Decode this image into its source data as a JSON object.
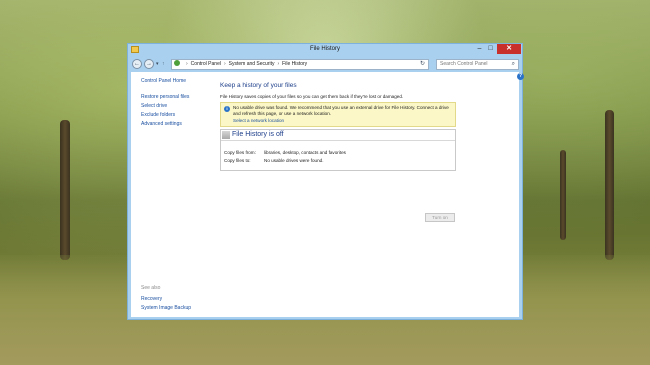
{
  "window": {
    "title": "File History",
    "controls": {
      "minimize": "–",
      "maximize": "□",
      "close": "✕"
    }
  },
  "address": {
    "breadcrumb": [
      "Control Panel",
      "System and Security",
      "File History"
    ],
    "search_placeholder": "Search Control Panel"
  },
  "sidebar": {
    "home": "Control Panel Home",
    "items": [
      "Restore personal files",
      "Select drive",
      "Exclude folders",
      "Advanced settings"
    ],
    "see_also_label": "See also",
    "see_also": [
      "Recovery",
      "System Image Backup"
    ]
  },
  "main": {
    "heading": "Keep a history of your files",
    "description": "File History saves copies of your files so you can get them back if they're lost or damaged.",
    "notice": {
      "text": "No usable drive was found. We recommend that you use an external drive for File History. Connect a drive and refresh this page, or use a network location.",
      "link": "Select a network location"
    },
    "status": {
      "title": "File History is off",
      "rows": [
        {
          "label": "Copy files from:",
          "value": "libraries, desktop, contacts and favorites"
        },
        {
          "label": "Copy files to:",
          "value": "No usable drives were found."
        }
      ]
    },
    "turn_on_label": "Turn on"
  },
  "colors": {
    "window_frame": "#a9d0ef",
    "close_button": "#c8312b",
    "link": "#1a4fa0",
    "notice_background": "#fbf7c6"
  }
}
